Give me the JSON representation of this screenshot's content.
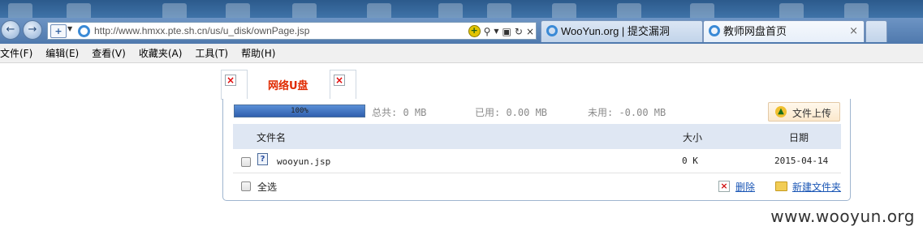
{
  "browser": {
    "url": "http://www.hmxx.pte.sh.cn/us/u_disk/ownPage.jsp",
    "tabs": [
      {
        "title": "WooYun.org | 提交漏洞",
        "active": false
      },
      {
        "title": "教师网盘首页",
        "active": true
      }
    ],
    "close_glyph": "×"
  },
  "menubar": {
    "items": [
      "文件(F)",
      "编辑(E)",
      "查看(V)",
      "收藏夹(A)",
      "工具(T)",
      "帮助(H)"
    ]
  },
  "udisk": {
    "tab_label": "网络U盘",
    "quota": {
      "percent_label": "100%",
      "fill_fraction": 1.0,
      "total": "总共: 0 MB",
      "used": "已用: 0.00 MB",
      "free": "未用: -0.00 MB"
    },
    "upload_label": "文件上传",
    "columns": {
      "name": "文件名",
      "size": "大小",
      "date": "日期"
    },
    "files": [
      {
        "name": "wooyun.jsp",
        "size": "0 K",
        "date": "2015-04-14"
      }
    ],
    "select_all": "全选",
    "delete_label": "删除",
    "new_folder_label": "新建文件夹"
  },
  "watermark": "www.wooyun.org",
  "colors": {
    "accent_red": "#e02a00",
    "link_blue": "#1a56b5",
    "header_bg": "#dfe7f3",
    "progress_fill": "#2f5fae"
  },
  "icons": {
    "back": "back-arrow-icon",
    "forward": "forward-arrow-icon",
    "compat": "compatibility-view-icon",
    "search": "search-icon",
    "refresh": "refresh-icon",
    "stop": "stop-icon",
    "broken_image": "broken-image-icon",
    "upload": "upload-icon",
    "file": "unknown-file-icon",
    "delete": "delete-icon",
    "new_folder": "new-folder-icon"
  }
}
